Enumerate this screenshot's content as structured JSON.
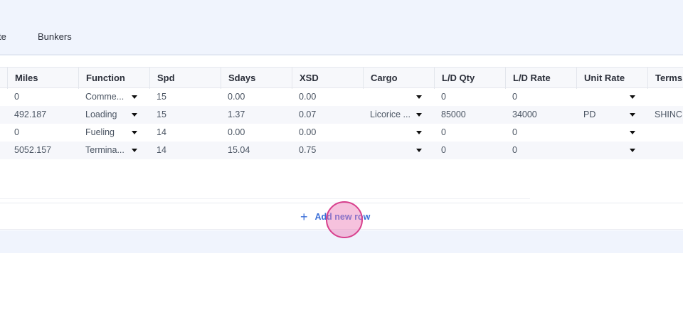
{
  "tabs": [
    {
      "label": "te"
    },
    {
      "label": "Bunkers"
    }
  ],
  "columns": [
    {
      "key": "miles",
      "label": "Miles"
    },
    {
      "key": "function",
      "label": "Function"
    },
    {
      "key": "spd",
      "label": "Spd"
    },
    {
      "key": "sdays",
      "label": "Sdays"
    },
    {
      "key": "xsd",
      "label": "XSD"
    },
    {
      "key": "cargo",
      "label": "Cargo"
    },
    {
      "key": "ld_qty",
      "label": "L/D Qty"
    },
    {
      "key": "ld_rate",
      "label": "L/D Rate"
    },
    {
      "key": "unit_rate",
      "label": "Unit Rate"
    },
    {
      "key": "terms",
      "label": "Terms"
    }
  ],
  "rows": [
    {
      "miles": "0",
      "function": "Comme...",
      "spd": "15",
      "sdays": "0.00",
      "xsd": "0.00",
      "cargo": "",
      "ld_qty": "0",
      "ld_rate": "0",
      "unit_rate": "",
      "terms": ""
    },
    {
      "miles": "492.187",
      "function": "Loading",
      "spd": "15",
      "sdays": "1.37",
      "xsd": "0.07",
      "cargo": "Licorice ...",
      "ld_qty": "85000",
      "ld_rate": "34000",
      "unit_rate": "PD",
      "terms": "SHINC"
    },
    {
      "miles": "0",
      "function": "Fueling",
      "spd": "14",
      "sdays": "0.00",
      "xsd": "0.00",
      "cargo": "",
      "ld_qty": "0",
      "ld_rate": "0",
      "unit_rate": "",
      "terms": ""
    },
    {
      "miles": "5052.157",
      "function": "Termina...",
      "spd": "14",
      "sdays": "15.04",
      "xsd": "0.75",
      "cargo": "",
      "ld_qty": "0",
      "ld_rate": "0",
      "unit_rate": "",
      "terms": ""
    }
  ],
  "add_row": {
    "label": "Add new row",
    "icon": "plus-icon"
  },
  "colors": {
    "accent": "#3b6fd8",
    "band": "#f0f4fd",
    "cursor": "#d8408d"
  }
}
